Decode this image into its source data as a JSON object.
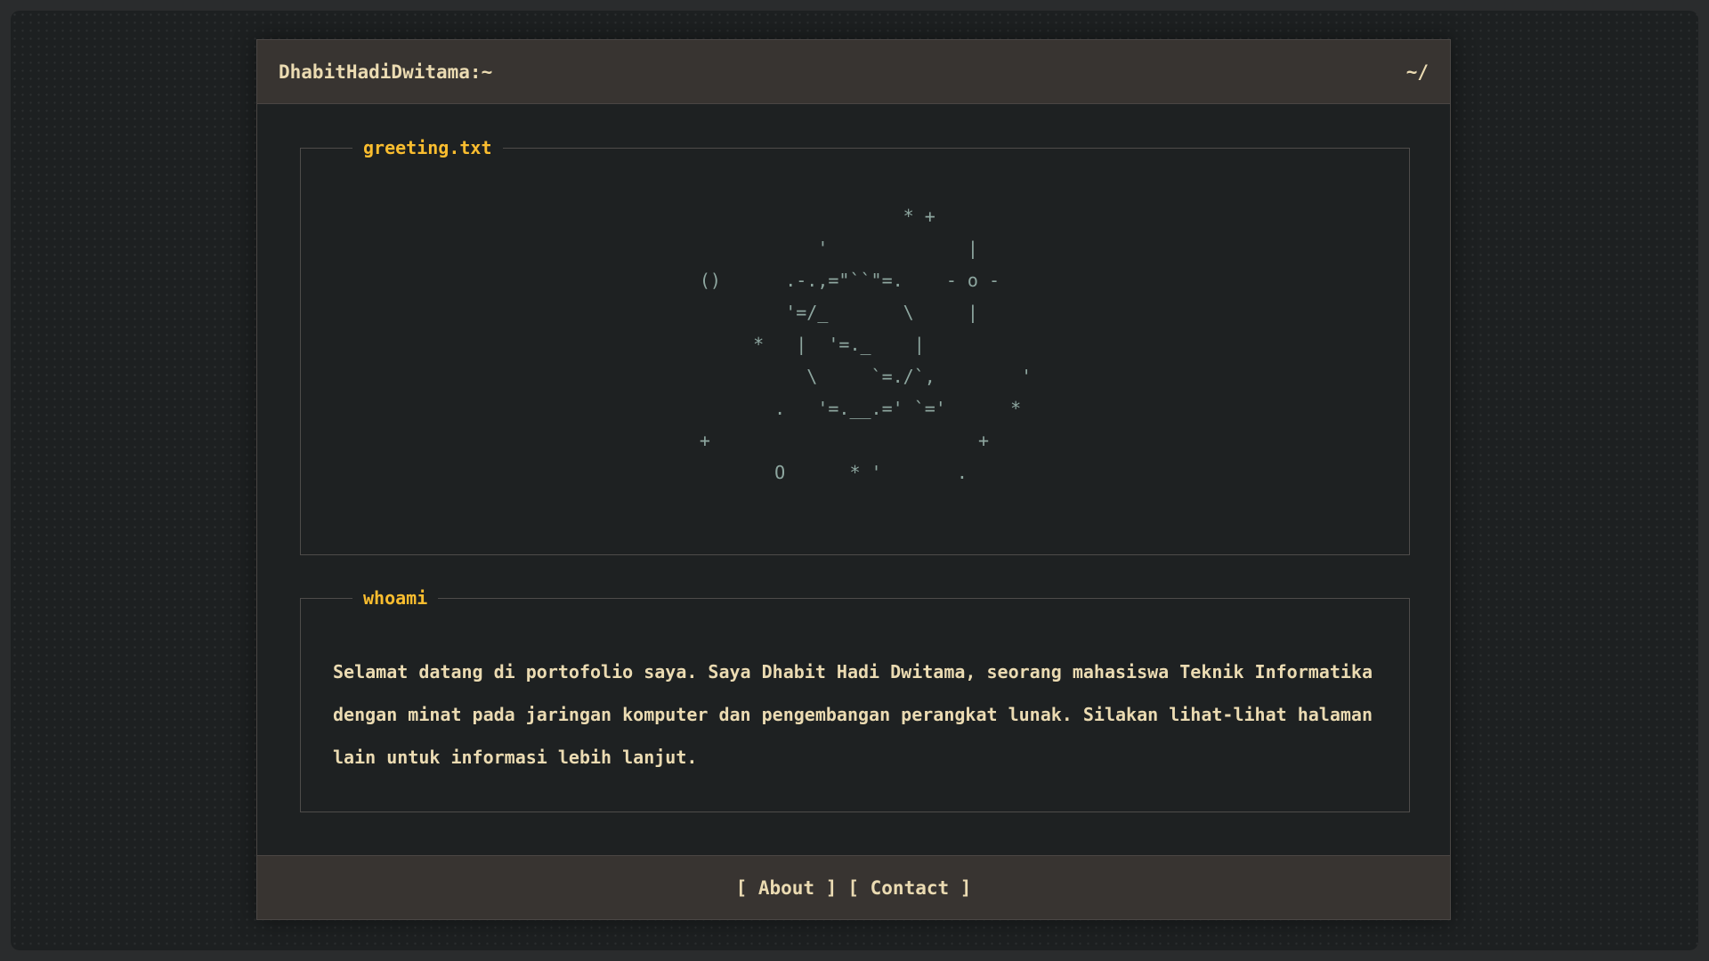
{
  "window": {
    "title": "DhabitHadiDwitama:~",
    "path": "~/"
  },
  "greeting": {
    "legend": "greeting.txt",
    "ascii_art": "                     * +\n             '             |\n  ()      .-.,=\"``\"=.    - o -\n          '=/_       \\     |\n       *   |  '=._    |\n            \\     `=./`,        '\n         .   '=.__.=' `='      *\n  +                         +\n         O      * '       ."
  },
  "whoami": {
    "legend": "whoami",
    "text": "Selamat datang di portofolio saya. Saya Dhabit Hadi Dwitama, seorang mahasiswa Teknik Informatika dengan minat pada jaringan komputer dan pengembangan perangkat lunak. Silakan lihat-lihat halaman lain untuk informasi lebih lanjut."
  },
  "footer": {
    "about_link": "[ About ]",
    "contact_link": "[ Contact ]"
  },
  "colors": {
    "accent": "#fabd2f",
    "text": "#ebdbb2",
    "ascii": "#8ea7a0",
    "bar": "#383431",
    "background": "#1e2122"
  }
}
